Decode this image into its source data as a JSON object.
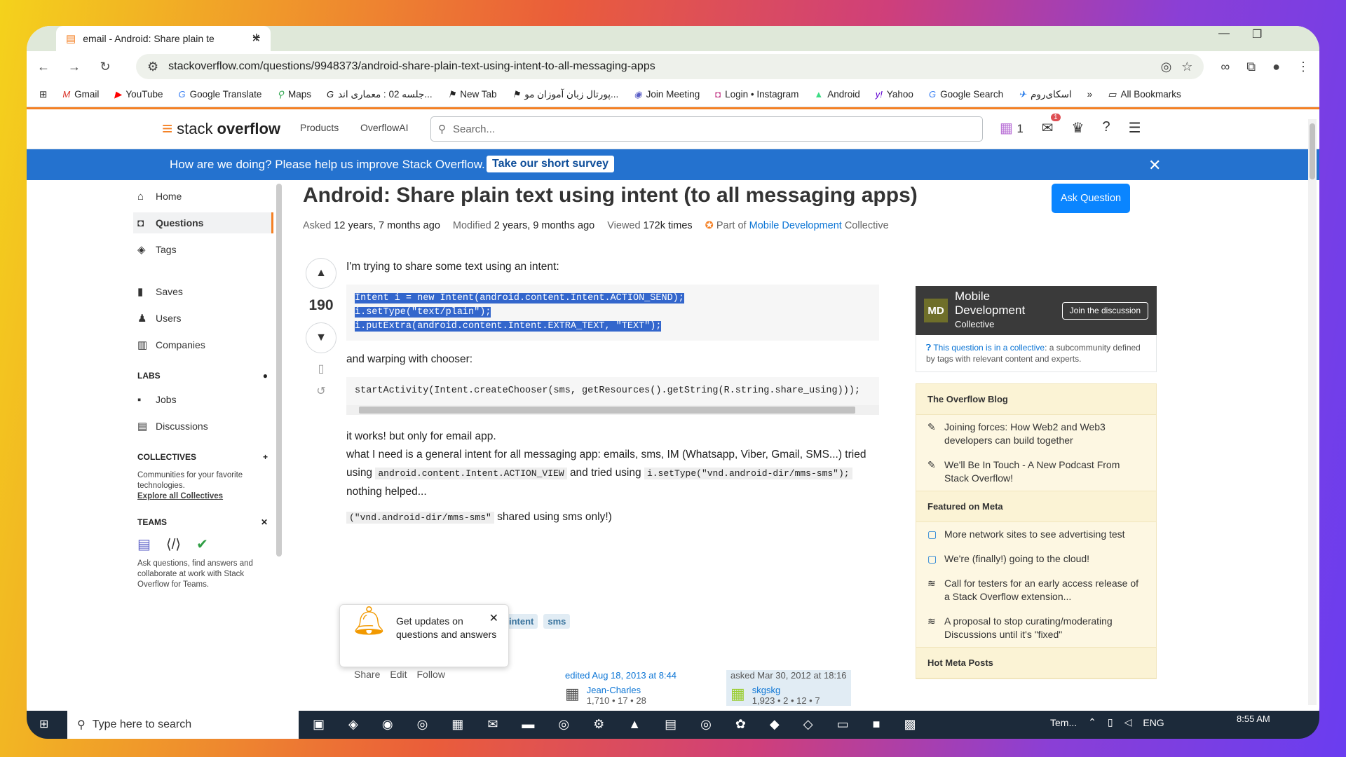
{
  "browser": {
    "tab_title": "email - Android: Share plain te",
    "url": "stackoverflow.com/questions/9948373/android-share-plain-text-using-intent-to-all-messaging-apps",
    "bookmarks": [
      "Gmail",
      "YouTube",
      "Google Translate",
      "Maps",
      "جلسه 02 : معماری اند...",
      "New Tab",
      "پورتال زبان آموزان مو...",
      "Join Meeting",
      "Login • Instagram",
      "Android",
      "Yahoo",
      "Google Search",
      "اسکای‌روم"
    ],
    "all_bookmarks": "All Bookmarks"
  },
  "so": {
    "logo_a": "stack",
    "logo_b": "overflow",
    "nav_products": "Products",
    "nav_ai": "OverflowAI",
    "search_placeholder": "Search...",
    "rep": "1",
    "inbox_count": "1"
  },
  "banner": {
    "text": "How are we doing? Please help us improve Stack Overflow.",
    "button": "Take our short survey"
  },
  "sidebar": {
    "home": "Home",
    "questions": "Questions",
    "tags": "Tags",
    "saves": "Saves",
    "users": "Users",
    "companies": "Companies",
    "labs": "LABS",
    "jobs": "Jobs",
    "discussions": "Discussions",
    "collectives": "COLLECTIVES",
    "coll_desc": "Communities for your favorite technologies.",
    "coll_link": "Explore all Collectives",
    "teams": "TEAMS",
    "teams_desc": "Ask questions, find answers and collaborate at work with Stack Overflow for Teams."
  },
  "question": {
    "title": "Android: Share plain text using intent (to all messaging apps)",
    "ask_button": "Ask Question",
    "asked_label": "Asked",
    "asked_value": "12 years, 7 months ago",
    "modified_label": "Modified",
    "modified_value": "2 years, 9 months ago",
    "viewed_label": "Viewed",
    "viewed_value": "172k times",
    "part_of": "Part of",
    "collective_link": "Mobile Development",
    "collective_word": "Collective",
    "votes": "190",
    "p1": "I'm trying to share some text using an intent:",
    "code1_l1": "Intent i = new Intent(android.content.Intent.ACTION_SEND);",
    "code1_l2": "i.setType(\"text/plain\");",
    "code1_l3": "i.putExtra(android.content.Intent.EXTRA_TEXT, \"TEXT\");",
    "p2": "and warping with chooser:",
    "code2": "startActivity(Intent.createChooser(sms, getResources().getString(R.string.share_using)));",
    "p3": "it works! but only for email app.",
    "p4a": "what I need is a general intent for all messaging app: emails, sms, IM (Whatsapp, Viber, Gmail, SMS...) tried using",
    "p4code1": "android.content.Intent.ACTION_VIEW",
    "p4b": "and tried using",
    "p4code2": "i.setType(\"vnd.android-dir/mms-sms\");",
    "p4c": "nothing helped...",
    "p5code": "(\"vnd.android-dir/mms-sms\"",
    "p5": "shared using sms only!)",
    "tags": [
      "intent",
      "sms"
    ],
    "actions": [
      "Share",
      "Edit",
      "Follow"
    ],
    "edited": "edited Aug 18, 2013 at 8:44",
    "editor": "Jean-Charles",
    "editor_rep": "1,710 • 17 • 28",
    "asked_on": "asked Mar 30, 2012 at 18:16",
    "asker": "skgskg",
    "asker_rep": "1,923 • 2 • 12 • 7"
  },
  "popup": {
    "text": "Get updates on questions and answers"
  },
  "collective": {
    "badge": "MD",
    "name": "Mobile Development",
    "sub": "Collective",
    "join": "Join the discussion",
    "note_link": "This question is in a collective",
    "note": ": a subcommunity defined by tags with relevant content and experts."
  },
  "blog": {
    "title": "The Overflow Blog",
    "items": [
      "Joining forces: How Web2 and Web3 developers can build together",
      "We'll Be In Touch - A New Podcast From Stack Overflow!"
    ]
  },
  "meta": {
    "title": "Featured on Meta",
    "items": [
      "More network sites to see advertising test",
      "We're (finally!) going to the cloud!",
      "Call for testers for an early access release of a Stack Overflow extension...",
      "A proposal to stop curating/moderating Discussions until it's \"fixed\""
    ]
  },
  "hot": {
    "title": "Hot Meta Posts"
  },
  "taskbar": {
    "search": "Type here to search",
    "weather": "Tem...",
    "lang": "ENG",
    "time": "8:55 AM"
  }
}
